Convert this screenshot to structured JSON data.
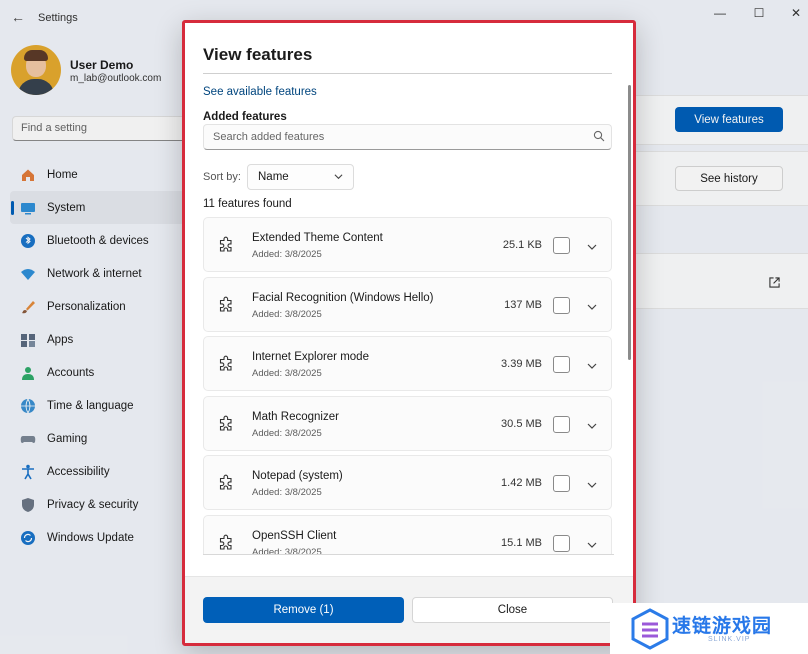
{
  "window": {
    "title": "Settings",
    "controls": {
      "minimize": "—",
      "maximize": "☐",
      "close": "✕"
    }
  },
  "profile": {
    "name": "User Demo",
    "email": "m_lab@outlook.com"
  },
  "search": {
    "placeholder": "Find a setting"
  },
  "sidebar": {
    "items": [
      {
        "label": "Home",
        "icon": "home-icon",
        "active": false
      },
      {
        "label": "System",
        "icon": "system-icon",
        "active": true
      },
      {
        "label": "Bluetooth & devices",
        "icon": "bluetooth-icon",
        "active": false
      },
      {
        "label": "Network & internet",
        "icon": "wifi-icon",
        "active": false
      },
      {
        "label": "Personalization",
        "icon": "brush-icon",
        "active": false
      },
      {
        "label": "Apps",
        "icon": "apps-icon",
        "active": false
      },
      {
        "label": "Accounts",
        "icon": "person-icon",
        "active": false
      },
      {
        "label": "Time & language",
        "icon": "globe-icon",
        "active": false
      },
      {
        "label": "Gaming",
        "icon": "gamepad-icon",
        "active": false
      },
      {
        "label": "Accessibility",
        "icon": "accessibility-icon",
        "active": false
      },
      {
        "label": "Privacy & security",
        "icon": "shield-icon",
        "active": false
      },
      {
        "label": "Windows Update",
        "icon": "update-icon",
        "active": false
      }
    ]
  },
  "background": {
    "view_features_label": "View features",
    "see_history_label": "See history"
  },
  "dialog": {
    "title": "View features",
    "see_available_link": "See available features",
    "added_heading": "Added features",
    "search_placeholder": "Search added features",
    "sort_label": "Sort by:",
    "sort_value": "Name",
    "found_text": "11 features found",
    "features": [
      {
        "name": "Extended Theme Content",
        "added": "Added: 3/8/2025",
        "size": "25.1 KB"
      },
      {
        "name": "Facial Recognition (Windows Hello)",
        "added": "Added: 3/8/2025",
        "size": "137 MB"
      },
      {
        "name": "Internet Explorer mode",
        "added": "Added: 3/8/2025",
        "size": "3.39 MB"
      },
      {
        "name": "Math Recognizer",
        "added": "Added: 3/8/2025",
        "size": "30.5 MB"
      },
      {
        "name": "Notepad (system)",
        "added": "Added: 3/8/2025",
        "size": "1.42 MB"
      },
      {
        "name": "OpenSSH Client",
        "added": "Added: 3/8/2025",
        "size": "15.1 MB"
      }
    ],
    "remove_label": "Remove (1)",
    "close_label": "Close"
  },
  "watermark": {
    "text": "速链游戏园",
    "sub": "SLINK.VIP"
  },
  "colors": {
    "accent": "#005fb8",
    "highlight_border": "#d62b3c",
    "watermark": "#2878e9"
  }
}
